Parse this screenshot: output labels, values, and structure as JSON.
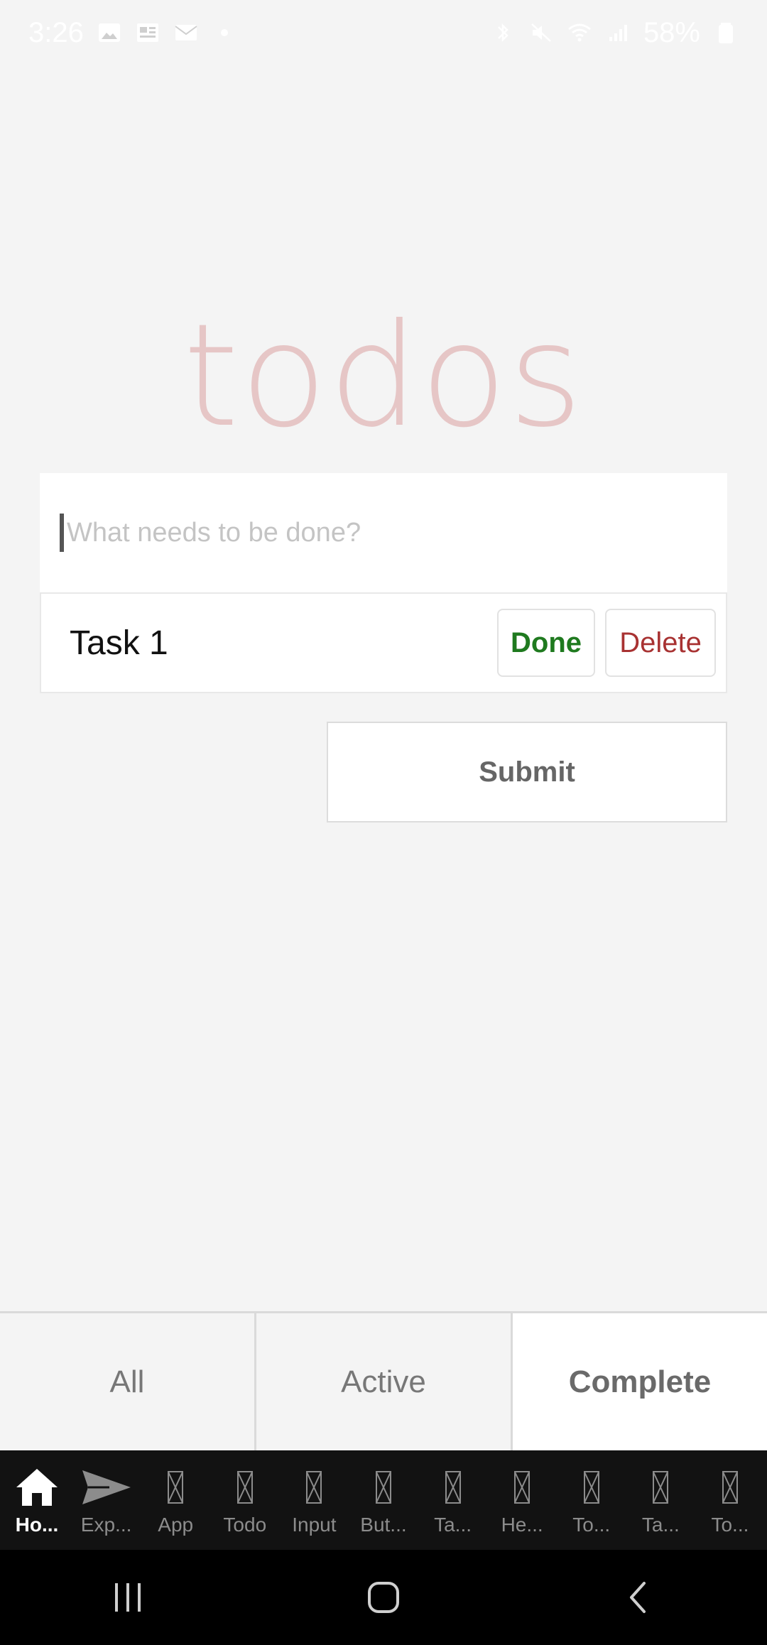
{
  "status_bar": {
    "time": "3:26",
    "battery": "58%",
    "icons": [
      "image-icon",
      "news-icon",
      "mail-icon",
      "dot-icon",
      "bluetooth-icon",
      "mute-icon",
      "wifi-icon",
      "signal-icon",
      "battery-icon"
    ]
  },
  "app": {
    "title": "todos"
  },
  "new_todo": {
    "placeholder": "What needs to be done?",
    "value": ""
  },
  "tasks": [
    {
      "label": "Task 1",
      "done_label": "Done",
      "delete_label": "Delete"
    }
  ],
  "submit_label": "Submit",
  "filters": {
    "items": [
      {
        "label": "All",
        "selected": false
      },
      {
        "label": "Active",
        "selected": false
      },
      {
        "label": "Complete",
        "selected": true
      }
    ]
  },
  "bottom_nav": {
    "items": [
      {
        "label": "Ho...",
        "icon": "home-icon",
        "active": true
      },
      {
        "label": "Exp...",
        "icon": "send-icon",
        "active": false
      },
      {
        "label": "App",
        "icon": "missing-glyph-icon",
        "active": false
      },
      {
        "label": "Todo",
        "icon": "missing-glyph-icon",
        "active": false
      },
      {
        "label": "Input",
        "icon": "missing-glyph-icon",
        "active": false
      },
      {
        "label": "But...",
        "icon": "missing-glyph-icon",
        "active": false
      },
      {
        "label": "Ta...",
        "icon": "missing-glyph-icon",
        "active": false
      },
      {
        "label": "He...",
        "icon": "missing-glyph-icon",
        "active": false
      },
      {
        "label": "To...",
        "icon": "missing-glyph-icon",
        "active": false
      },
      {
        "label": "Ta...",
        "icon": "missing-glyph-icon",
        "active": false
      },
      {
        "label": "To...",
        "icon": "missing-glyph-icon",
        "active": false
      }
    ]
  },
  "colors": {
    "background": "#f4f4f4",
    "title": "#e6c6c6",
    "done": "#1f7a1f",
    "delete": "#a83232",
    "nav_bg": "#121212"
  }
}
